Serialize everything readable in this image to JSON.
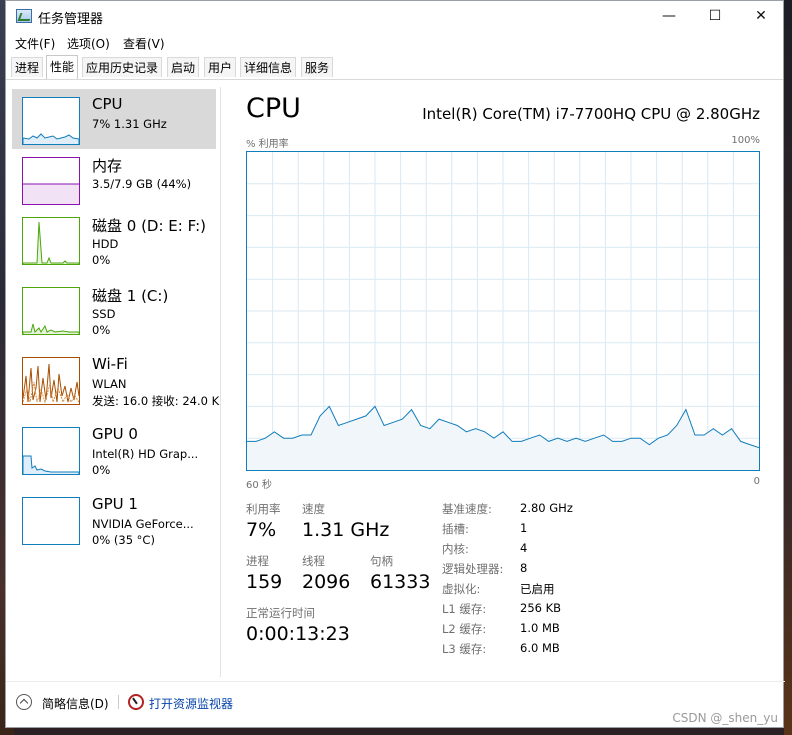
{
  "window": {
    "title": "任务管理器",
    "controls": [
      "—",
      "☐",
      "✕"
    ]
  },
  "menu": [
    "文件(F)",
    "选项(O)",
    "查看(V)"
  ],
  "tabs": [
    "进程",
    "性能",
    "应用历史记录",
    "启动",
    "用户",
    "详细信息",
    "服务"
  ],
  "active_tab": "性能",
  "sidebar": [
    {
      "name": "CPU",
      "line1": "7% 1.31 GHz",
      "line2": "",
      "line3": "",
      "color": "#117dbb"
    },
    {
      "name": "内存",
      "line1": "3.5/7.9 GB (44%)",
      "line2": "",
      "line3": "",
      "color": "#8b12ae"
    },
    {
      "name": "磁盘 0 (D: E: F:)",
      "line1": "HDD",
      "line2": "0%",
      "line3": "",
      "color": "#4da60c"
    },
    {
      "name": "磁盘 1 (C:)",
      "line1": "SSD",
      "line2": "0%",
      "line3": "",
      "color": "#4da60c"
    },
    {
      "name": "Wi-Fi",
      "line1": "WLAN",
      "line2": "发送: 16.0  接收: 24.0 K",
      "line3": "",
      "color": "#a74f01"
    },
    {
      "name": "GPU 0",
      "line1": "Intel(R) HD Grap...",
      "line2": "0%",
      "line3": "",
      "color": "#117dbb"
    },
    {
      "name": "GPU 1",
      "line1": "NVIDIA GeForce...",
      "line2": "0% (35 °C)",
      "line3": "",
      "color": "#117dbb"
    }
  ],
  "main": {
    "title": "CPU",
    "model": "Intel(R) Core(TM) i7-7700HQ CPU @ 2.80GHz",
    "graph_label_left": "% 利用率",
    "graph_label_right": "100%",
    "time_left": "60 秒",
    "time_right": "0",
    "stats": {
      "util_label": "利用率",
      "util_value": "7%",
      "speed_label": "速度",
      "speed_value": "1.31 GHz",
      "proc_label": "进程",
      "proc_value": "159",
      "thread_label": "线程",
      "thread_value": "2096",
      "handle_label": "句柄",
      "handle_value": "61333",
      "uptime_label": "正常运行时间",
      "uptime_value": "0:00:13:23"
    },
    "specs": [
      {
        "label": "基准速度:",
        "value": "2.80 GHz"
      },
      {
        "label": "插槽:",
        "value": "1"
      },
      {
        "label": "内核:",
        "value": "4"
      },
      {
        "label": "逻辑处理器:",
        "value": "8"
      },
      {
        "label": "虚拟化:",
        "value": "已启用"
      },
      {
        "label": "L1 缓存:",
        "value": "256 KB"
      },
      {
        "label": "L2 缓存:",
        "value": "1.0 MB"
      },
      {
        "label": "L3 缓存:",
        "value": "6.0 MB"
      }
    ]
  },
  "footer": {
    "collapse_label": "简略信息(D)",
    "monitor_label": "打开资源监视器"
  },
  "watermark": "CSDN @_shen_yu",
  "cpu_usage_history": [
    9,
    9,
    10,
    12,
    10,
    10,
    11,
    11,
    17,
    20,
    14,
    15,
    16,
    17,
    20,
    14,
    15,
    16,
    19,
    14,
    13,
    16,
    15,
    14,
    12,
    13,
    12,
    10,
    12,
    9,
    9,
    10,
    11,
    9,
    10,
    9,
    10,
    9,
    10,
    11,
    9,
    9,
    10,
    10,
    8,
    10,
    11,
    14,
    19,
    11,
    11,
    13,
    11,
    13,
    9,
    8,
    7
  ],
  "colors": {
    "cpu": "#117dbb",
    "memory": "#8b12ae",
    "disk": "#4da60c",
    "wifi": "#a74f01"
  }
}
